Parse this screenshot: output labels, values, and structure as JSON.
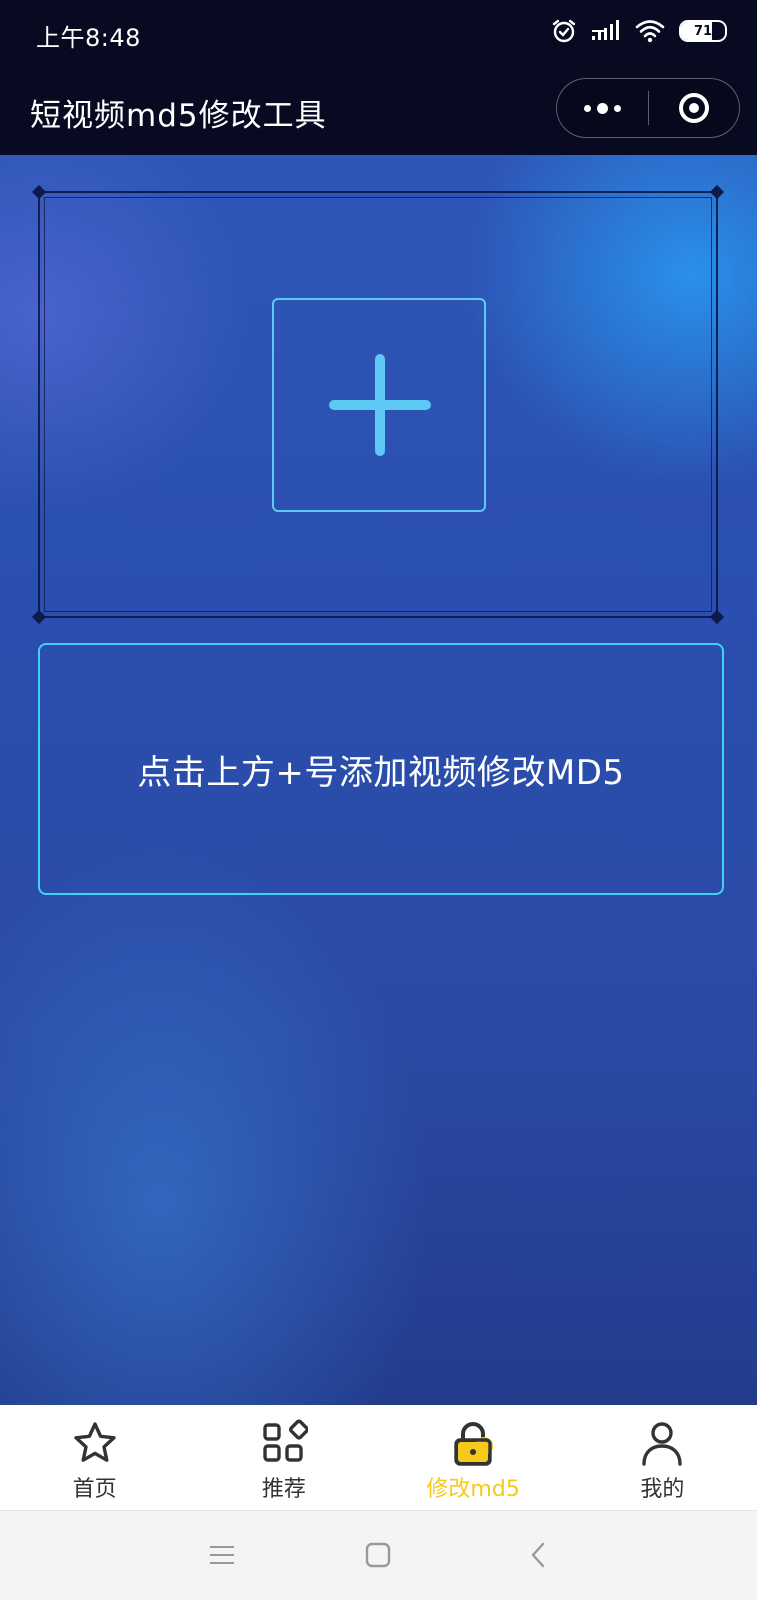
{
  "status": {
    "time": "上午8:48",
    "battery": "71",
    "battery_level": 0.71
  },
  "nav": {
    "title": "短视频md5修改工具"
  },
  "upload": {
    "add_icon": "plus-icon"
  },
  "hint": {
    "text": "点击上方+号添加视频修改MD5"
  },
  "tabs": [
    {
      "label": "首页",
      "icon": "star-icon",
      "active": false
    },
    {
      "label": "推荐",
      "icon": "grid-icon",
      "active": false
    },
    {
      "label": "修改md5",
      "icon": "lock-icon",
      "active": true
    },
    {
      "label": "我的",
      "icon": "user-icon",
      "active": false
    }
  ],
  "colors": {
    "accent": "#5ec9f5",
    "hint_border": "#3ed2f4",
    "active_tab": "#f7c91d",
    "nav_bg": "#080a22"
  }
}
